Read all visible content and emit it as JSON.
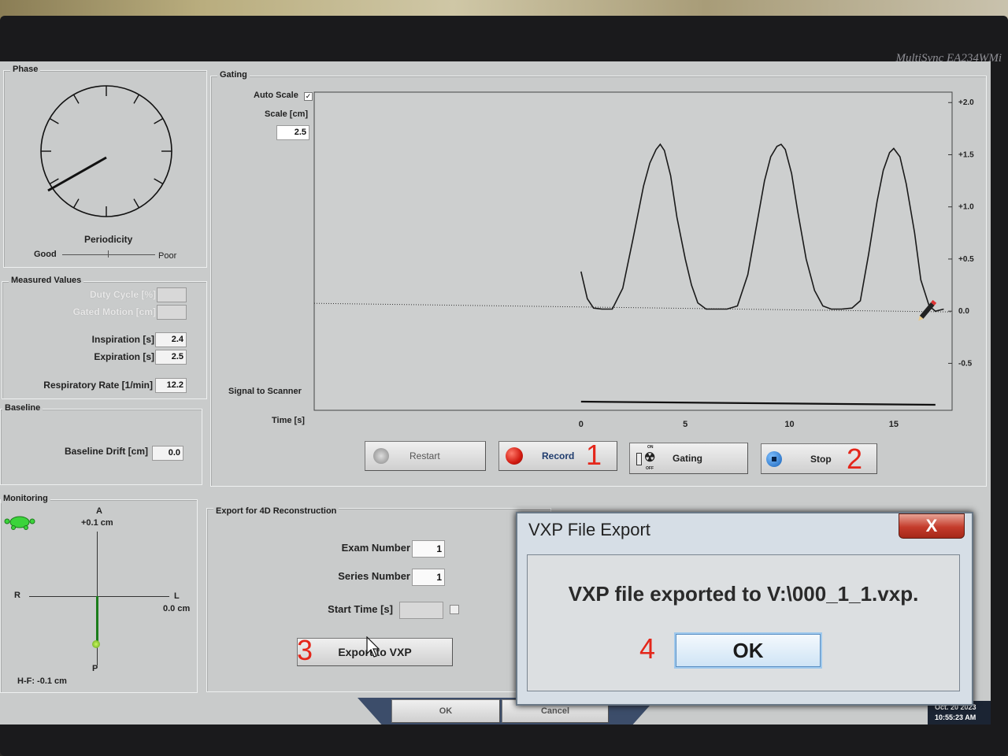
{
  "monitor": {
    "brand": "MultiSync EA234WMi"
  },
  "phase": {
    "title": "Phase",
    "periodicity_label": "Periodicity",
    "good_label": "Good",
    "poor_label": "Poor"
  },
  "measured": {
    "title": "Measured Values",
    "duty_cycle_label": "Duty Cycle [%]",
    "duty_cycle_value": "",
    "gated_motion_label": "Gated Motion [cm]",
    "gated_motion_value": "",
    "inspiration_label": "Inspiration [s]",
    "inspiration_value": "2.4",
    "expiration_label": "Expiration [s]",
    "expiration_value": "2.5",
    "resp_rate_label": "Respiratory Rate [1/min]",
    "resp_rate_value": "12.2"
  },
  "baseline": {
    "title": "Baseline",
    "drift_label": "Baseline Drift [cm]",
    "drift_value": "0.0"
  },
  "monitoring": {
    "title": "Monitoring",
    "a_label": "A",
    "a_value": "+0.1 cm",
    "r_label": "R",
    "l_label": "L",
    "l_value": "0.0 cm",
    "p_label": "P",
    "hf_label": "H-F: -0.1 cm"
  },
  "gating": {
    "title": "Gating",
    "auto_scale_label": "Auto Scale",
    "auto_scale_checked": true,
    "scale_label": "Scale [cm]",
    "scale_value": "2.5",
    "signal_label": "Signal to Scanner",
    "time_label": "Time [s]",
    "y_ticks": [
      "+2.0",
      "+1.5",
      "+1.0",
      "+0.5",
      "0.0",
      "-0.5"
    ],
    "x_ticks": [
      "0",
      "5",
      "10",
      "15"
    ]
  },
  "chart_data": {
    "type": "line",
    "xlabel": "Time [s]",
    "ylim": [
      -0.95,
      2.1
    ],
    "xlim": [
      -12.8,
      17.8
    ],
    "series": [
      {
        "x": [
          0.0,
          0.3,
          0.6,
          1.0,
          1.5,
          2.0,
          2.5,
          3.0,
          3.3,
          3.6,
          3.8,
          4.0,
          4.3,
          4.6,
          5.0,
          5.3,
          5.6,
          6.0,
          6.5,
          7.0,
          7.5,
          8.0,
          8.4,
          8.8,
          9.1,
          9.4,
          9.6,
          9.8,
          10.1,
          10.4,
          10.8,
          11.2,
          11.6,
          12.0,
          12.5,
          13.0,
          13.4,
          13.8,
          14.2,
          14.5,
          14.8,
          15.0,
          15.3,
          15.6,
          16.0,
          16.3,
          16.7,
          17.0,
          17.4
        ],
        "y": [
          0.38,
          0.12,
          0.03,
          0.02,
          0.02,
          0.22,
          0.7,
          1.2,
          1.42,
          1.55,
          1.6,
          1.54,
          1.3,
          0.9,
          0.5,
          0.25,
          0.08,
          0.02,
          0.02,
          0.02,
          0.05,
          0.35,
          0.8,
          1.25,
          1.48,
          1.58,
          1.6,
          1.55,
          1.32,
          0.95,
          0.5,
          0.2,
          0.05,
          0.02,
          0.02,
          0.03,
          0.1,
          0.55,
          1.05,
          1.35,
          1.52,
          1.56,
          1.48,
          1.22,
          0.75,
          0.3,
          0.05,
          0.0,
          0.02
        ]
      }
    ],
    "signal_to_scanner": {
      "x_start": 0.0,
      "x_end": 17.0,
      "level": "on"
    },
    "baseline_y": 0.0
  },
  "controls": {
    "restart": "Restart",
    "record": "Record",
    "gating": "Gating",
    "gating_on": "ON",
    "gating_off": "OFF",
    "stop": "Stop"
  },
  "export": {
    "title": "Export for 4D Reconstruction",
    "exam_label": "Exam Number",
    "exam_value": "1",
    "series_label": "Series Number",
    "series_value": "1",
    "start_label": "Start Time [s]",
    "start_value": "",
    "export_button": "Export to VXP"
  },
  "footer": {
    "ok": "OK",
    "cancel": "Cancel",
    "date": "Oct. 20 2023",
    "time": "10:55:23 AM"
  },
  "dialog": {
    "title": "VXP File Export",
    "close": "X",
    "message": "VXP file exported to V:\\000_1_1.vxp.",
    "ok": "OK"
  },
  "annotations": [
    "1",
    "2",
    "3",
    "4"
  ]
}
